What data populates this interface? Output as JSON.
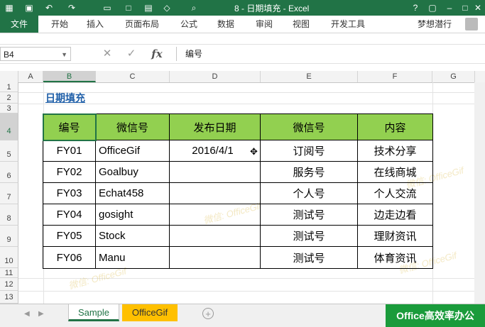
{
  "window": {
    "title": "8 - 日期填充 - Excel"
  },
  "ribbon": {
    "file_tab": "文件",
    "tabs": [
      "开始",
      "插入",
      "页面布局",
      "公式",
      "数据",
      "审阅",
      "视图",
      "开发工具"
    ],
    "user": "梦想潜行"
  },
  "formula_bar": {
    "name_box": "B4",
    "formula": "编号",
    "fx_label": "fx"
  },
  "sheet": {
    "columns": [
      "A",
      "B",
      "C",
      "D",
      "E",
      "F",
      "G"
    ],
    "rows": [
      "1",
      "2",
      "3",
      "4",
      "5",
      "6",
      "7",
      "8",
      "9",
      "10",
      "11",
      "12",
      "13"
    ],
    "heading": "日期填充",
    "table_header": [
      "编号",
      "微信号",
      "发布日期",
      "微信号",
      "内容"
    ],
    "table_rows": [
      [
        "FY01",
        "OfficeGif",
        "2016/4/1",
        "订阅号",
        "技术分享"
      ],
      [
        "FY02",
        "Goalbuy",
        "",
        "服务号",
        "在线商城"
      ],
      [
        "FY03",
        "Echat458",
        "",
        "个人号",
        "个人交流"
      ],
      [
        "FY04",
        "gosight",
        "",
        "测试号",
        "边走边看"
      ],
      [
        "FY05",
        "Stock",
        "",
        "测试号",
        "理财资讯"
      ],
      [
        "FY06",
        "Manu",
        "",
        "测试号",
        "体育资讯"
      ]
    ],
    "watermark": "微信: OfficeGif"
  },
  "sheet_tabs": {
    "tabs": [
      "Sample",
      "OfficeGif"
    ],
    "add_symbol": "+"
  },
  "brand": "Office高效率办公",
  "colors": {
    "excel_green": "#217346",
    "header_fill": "#92d050",
    "tab_highlight": "#ffc000",
    "brand_green": "#1a9b3b"
  }
}
